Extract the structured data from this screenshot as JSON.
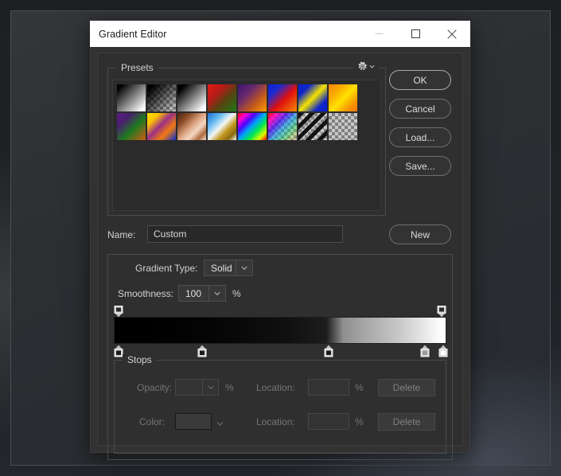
{
  "window": {
    "title": "Gradient Editor",
    "controls": {
      "minimize": "minimize-icon",
      "maximize": "maximize-icon",
      "close": "close-icon"
    }
  },
  "presets": {
    "label": "Presets",
    "menu_icon": "gear-icon",
    "items": [
      {
        "name": "foreground-to-background",
        "css": "linear-gradient(135deg, #000000 0%, #000000 10%, #ffffff 92%, #ffffff 100%)",
        "checker": false
      },
      {
        "name": "foreground-to-transparent",
        "css": "linear-gradient(135deg, #000000 0%, #000000 12%, rgba(0,0,0,0) 95%)",
        "checker": true
      },
      {
        "name": "black-to-white",
        "css": "linear-gradient(135deg, #000000 0%, #000000 14%, #ffffff 90%)",
        "checker": false
      },
      {
        "name": "red-green",
        "css": "linear-gradient(135deg, #e01b10 0%, #b81a18 32%, #5c4010 58%, #1d7a16 100%)",
        "checker": false
      },
      {
        "name": "violet-orange",
        "css": "linear-gradient(135deg, #3a1470 0%, #6b2a6e 34%, #c1591c 66%, #ff9d00 100%)",
        "checker": false
      },
      {
        "name": "blue-red-yellow",
        "css": "linear-gradient(135deg, #0a22d8 0%, #1b2ad0 24%, #e01010 56%, #f58a00 100%)",
        "checker": false
      },
      {
        "name": "blue-yellow-blue",
        "css": "linear-gradient(135deg, #0b1fd2 0%, #1026c8 22%, #f5e400 50%, #1026c8 78%, #0b1fd2 100%)",
        "checker": false
      },
      {
        "name": "orange-yellow-orange",
        "css": "linear-gradient(135deg, #f58400 0%, #fbb000 30%, #ffe200 52%, #f79200 80%, #ef7a00 100%)",
        "checker": false
      },
      {
        "name": "violet-green-orange",
        "css": "linear-gradient(135deg, #5b1d82 0%, #4a1f6e 26%, #1e7a20 58%, #d05a12 100%)",
        "checker": false
      },
      {
        "name": "yellow-violet-orange-blue",
        "css": "linear-gradient(135deg, #ffe000 0%, #ffc400 22%, #9b2f86 46%, #f07a10 70%, #0a2fd0 100%)",
        "checker": false
      },
      {
        "name": "copper",
        "css": "linear-gradient(135deg, #4d2412 0%, #8a4a26 24%, #e0a887 50%, #f3d7c4 66%, #b06a3c 84%, #f0e0d4 100%)",
        "checker": false
      },
      {
        "name": "chrome",
        "css": "linear-gradient(135deg, #1f6fd0 0%, #63b8f0 26%, #f2f6f8 48%, #c49a22 66%, #8a6a10 84%, #ffffff 100%)",
        "checker": false
      },
      {
        "name": "spectrum",
        "css": "linear-gradient(135deg, #ff0000 0%, #ff00d0 16%, #5000ff 32%, #00a0ff 48%, #00e850 66%, #d8ff00 84%, #ff0000 100%)",
        "checker": false
      },
      {
        "name": "transparent-rainbow",
        "css": "linear-gradient(135deg, rgba(255,0,0,0.95) 0%, rgba(255,0,200,0.85) 18%, rgba(60,0,255,0.7) 36%, rgba(0,170,255,0.55) 54%, rgba(0,230,90,0.4) 72%, rgba(220,255,0,0.2) 88%, rgba(255,255,255,0) 100%)",
        "checker": true
      },
      {
        "name": "transparent-stripes",
        "css": "repeating-linear-gradient(135deg, #111111 0px, #111111 5px, rgba(0,0,0,0) 5px, rgba(0,0,0,0) 10px)",
        "checker": true
      },
      {
        "name": "transparent",
        "css": "none",
        "checker": true
      }
    ]
  },
  "buttons": {
    "ok": "OK",
    "cancel": "Cancel",
    "load": "Load...",
    "save": "Save...",
    "new": "New"
  },
  "name_field": {
    "label": "Name:",
    "value": "Custom"
  },
  "gradient": {
    "type_label": "Gradient Type:",
    "type_value": "Solid",
    "smoothness_label": "Smoothness:",
    "smoothness_value": "100",
    "percent": "%",
    "bar_css": "linear-gradient(90deg, #000000 0%, #000000 8%, #050505 30%, #101010 52%, #1c1c1c 64%, #8e8e8e 69%, #a8a8a8 76%, #c8c8c8 86%, #ffffff 99%)",
    "opacity_stops": [
      {
        "name": "opacity-stop-left",
        "position": 1.5,
        "color": "#2a2a2a"
      },
      {
        "name": "opacity-stop-right",
        "position": 98.5,
        "color": "#2a2a2a"
      }
    ],
    "color_stops": [
      {
        "name": "color-stop-1",
        "position": 1.5,
        "color": "#1a1a1a"
      },
      {
        "name": "color-stop-2",
        "position": 26.5,
        "color": "#1a1a1a"
      },
      {
        "name": "color-stop-3",
        "position": 64.5,
        "color": "#1a1a1a"
      },
      {
        "name": "color-stop-4",
        "position": 93.5,
        "color": "#9a9a9a"
      },
      {
        "name": "color-stop-5",
        "position": 99.0,
        "color": "#ffffff"
      }
    ]
  },
  "stops": {
    "label": "Stops",
    "opacity_label": "Opacity:",
    "opacity_value": "",
    "opacity_percent": "%",
    "location1_label": "Location:",
    "location1_value": "",
    "location1_percent": "%",
    "delete1": "Delete",
    "color_label": "Color:",
    "color_value": "",
    "location2_label": "Location:",
    "location2_value": "",
    "location2_percent": "%",
    "delete2": "Delete"
  }
}
